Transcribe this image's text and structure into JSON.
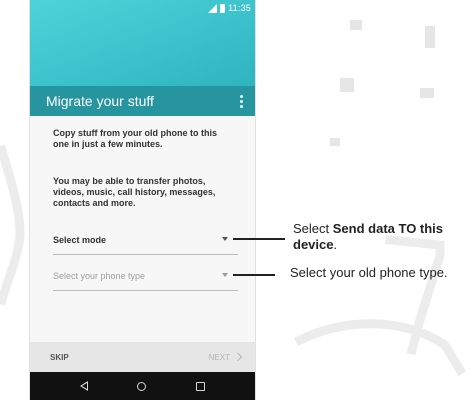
{
  "status_bar": {
    "time": "11:35"
  },
  "app_bar": {
    "title": "Migrate your stuff"
  },
  "content": {
    "paragraph_1": "Copy stuff from your old phone to this one in just a few minutes.",
    "paragraph_2": "You may be able to transfer photos, videos, music, call history, messages, contacts and more.",
    "select_mode": {
      "value": "Select mode"
    },
    "phone_type": {
      "placeholder": "Select your phone type"
    }
  },
  "bottom_bar": {
    "skip_label": "SKIP",
    "next_label": "NEXT"
  },
  "icons": {
    "signal": "signal-icon",
    "battery": "battery-icon",
    "overflow": "overflow-menu-icon",
    "back": "nav-back-icon",
    "home": "nav-home-icon",
    "recents": "nav-recents-icon"
  },
  "callouts": {
    "callout_1": {
      "prefix": "Select ",
      "bold": "Send data TO this device",
      "suffix": "."
    },
    "callout_2": {
      "text": "Select your old phone type."
    }
  },
  "colors": {
    "teal_top": "#3bc2cc",
    "app_bar": "#26959f",
    "nav_bar": "#111111"
  }
}
